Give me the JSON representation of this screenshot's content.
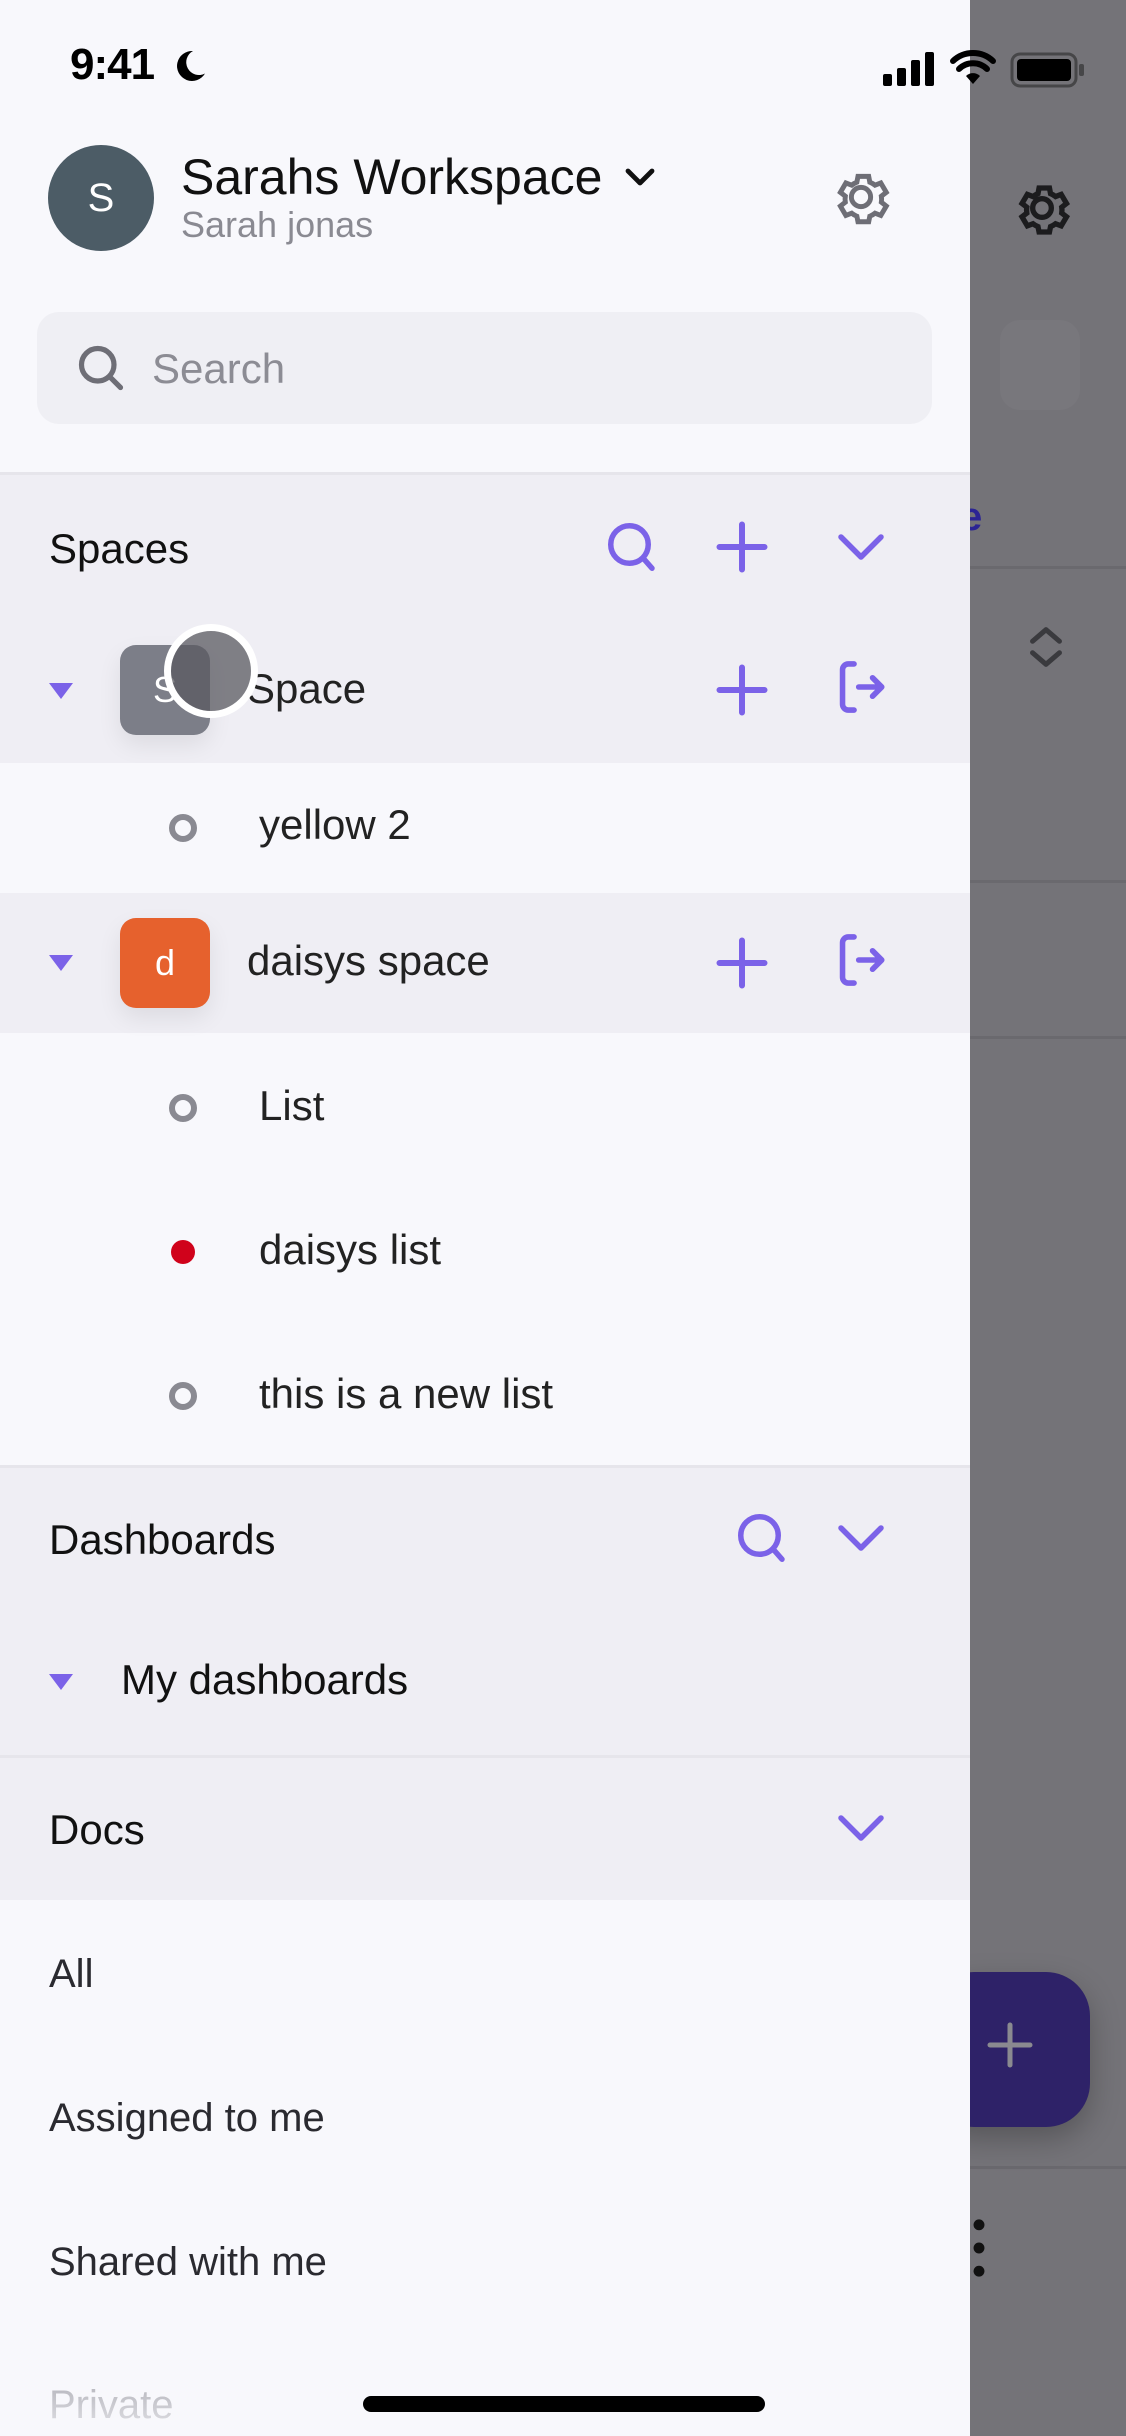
{
  "status_bar": {
    "time": "9:41"
  },
  "workspace": {
    "avatar_initial": "S",
    "title": "Sarahs Workspace",
    "subtitle": "Sarah jonas"
  },
  "search": {
    "placeholder": "Search",
    "value": ""
  },
  "spaces": {
    "title": "Spaces",
    "items": [
      {
        "name": "Space",
        "initial": "S",
        "color": "#7c7e88",
        "lists": [
          {
            "name": "yellow 2",
            "status": "empty"
          }
        ]
      },
      {
        "name": "daisys space",
        "initial": "d",
        "color": "#e6612d",
        "lists": [
          {
            "name": "List",
            "status": "empty"
          },
          {
            "name": "daisys list",
            "status": "red"
          },
          {
            "name": "this is a new list",
            "status": "empty"
          }
        ]
      }
    ]
  },
  "dashboards": {
    "title": "Dashboards",
    "items": [
      {
        "name": "My dashboards"
      }
    ]
  },
  "docs": {
    "title": "Docs",
    "items": [
      "All",
      "Assigned to me",
      "Shared with me",
      "Private"
    ]
  },
  "colors": {
    "accent": "#7b62e8",
    "status_red": "#d0021b",
    "status_empty": "#8a8a92",
    "fab": "#2e2268"
  }
}
